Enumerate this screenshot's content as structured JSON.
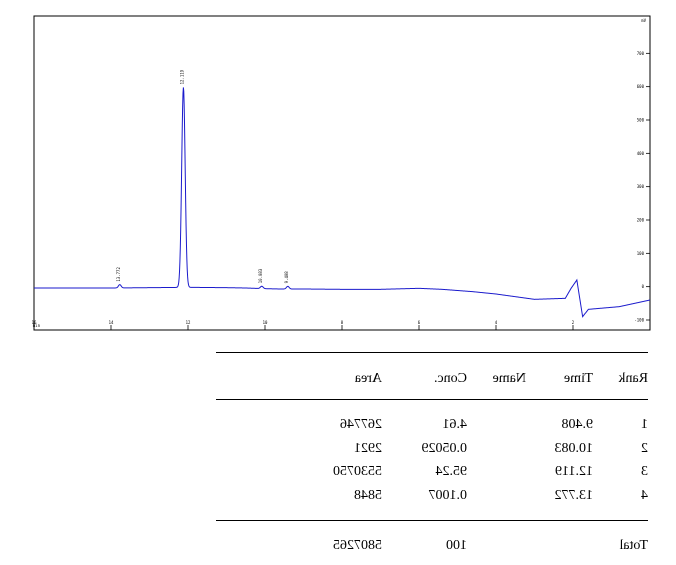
{
  "chart_data": {
    "type": "line",
    "title": "",
    "xlabel": "",
    "ylabel": "",
    "color": "#1a1acc",
    "mirrored": true,
    "xlim": [
      0,
      16
    ],
    "ylim": [
      -100,
      800
    ],
    "x_ticks": [
      "2",
      "4",
      "6",
      "8",
      "10",
      "12",
      "14",
      "16"
    ],
    "y_ticks": [
      "-100",
      "0",
      "100",
      "200",
      "300",
      "400",
      "500",
      "600",
      "700"
    ],
    "corner_label": "mV",
    "x_unit_label": "min",
    "baseline_points": [
      {
        "x": 0.0,
        "y": -40
      },
      {
        "x": 0.8,
        "y": -60
      },
      {
        "x": 1.6,
        "y": -68
      },
      {
        "x": 1.75,
        "y": -90
      },
      {
        "x": 1.9,
        "y": 20
      },
      {
        "x": 2.05,
        "y": -5
      },
      {
        "x": 2.2,
        "y": -35
      },
      {
        "x": 3.0,
        "y": -38
      },
      {
        "x": 3.5,
        "y": -30
      },
      {
        "x": 4.0,
        "y": -22
      },
      {
        "x": 4.6,
        "y": -15
      },
      {
        "x": 5.4,
        "y": -8
      },
      {
        "x": 6.0,
        "y": -5
      },
      {
        "x": 7.0,
        "y": -8
      },
      {
        "x": 8.0,
        "y": -8
      },
      {
        "x": 9.0,
        "y": -7
      },
      {
        "x": 9.6,
        "y": -7
      },
      {
        "x": 10.0,
        "y": -6
      },
      {
        "x": 10.5,
        "y": -4
      },
      {
        "x": 11.0,
        "y": -3
      },
      {
        "x": 12.0,
        "y": -2
      },
      {
        "x": 13.0,
        "y": -3
      },
      {
        "x": 14.0,
        "y": -4
      },
      {
        "x": 15.0,
        "y": -4
      },
      {
        "x": 16.0,
        "y": -4
      }
    ],
    "peaks": [
      {
        "rank": 1,
        "time": 9.408,
        "height": 8,
        "label": "9.408"
      },
      {
        "rank": 2,
        "time": 10.083,
        "height": 7,
        "label": "10.083"
      },
      {
        "rank": 3,
        "time": 12.119,
        "height": 600,
        "label": "12.119"
      },
      {
        "rank": 4,
        "time": 13.772,
        "height": 10,
        "label": "13.772"
      }
    ]
  },
  "report": {
    "headers": {
      "rank": "Rank",
      "time": "Time",
      "name": "Name",
      "conc": "Conc.",
      "area": "Area"
    },
    "rows": [
      {
        "rank": "1",
        "time": "9.408",
        "name": "",
        "conc": "4.61",
        "area": "267746"
      },
      {
        "rank": "2",
        "time": "10.083",
        "name": "",
        "conc": "0.05029",
        "area": "2921"
      },
      {
        "rank": "3",
        "time": "12.119",
        "name": "",
        "conc": "95.24",
        "area": "5530750"
      },
      {
        "rank": "4",
        "time": "13.772",
        "name": "",
        "conc": "0.1007",
        "area": "5848"
      }
    ],
    "total": {
      "label": "Total",
      "conc": "100",
      "area": "5807265"
    }
  }
}
